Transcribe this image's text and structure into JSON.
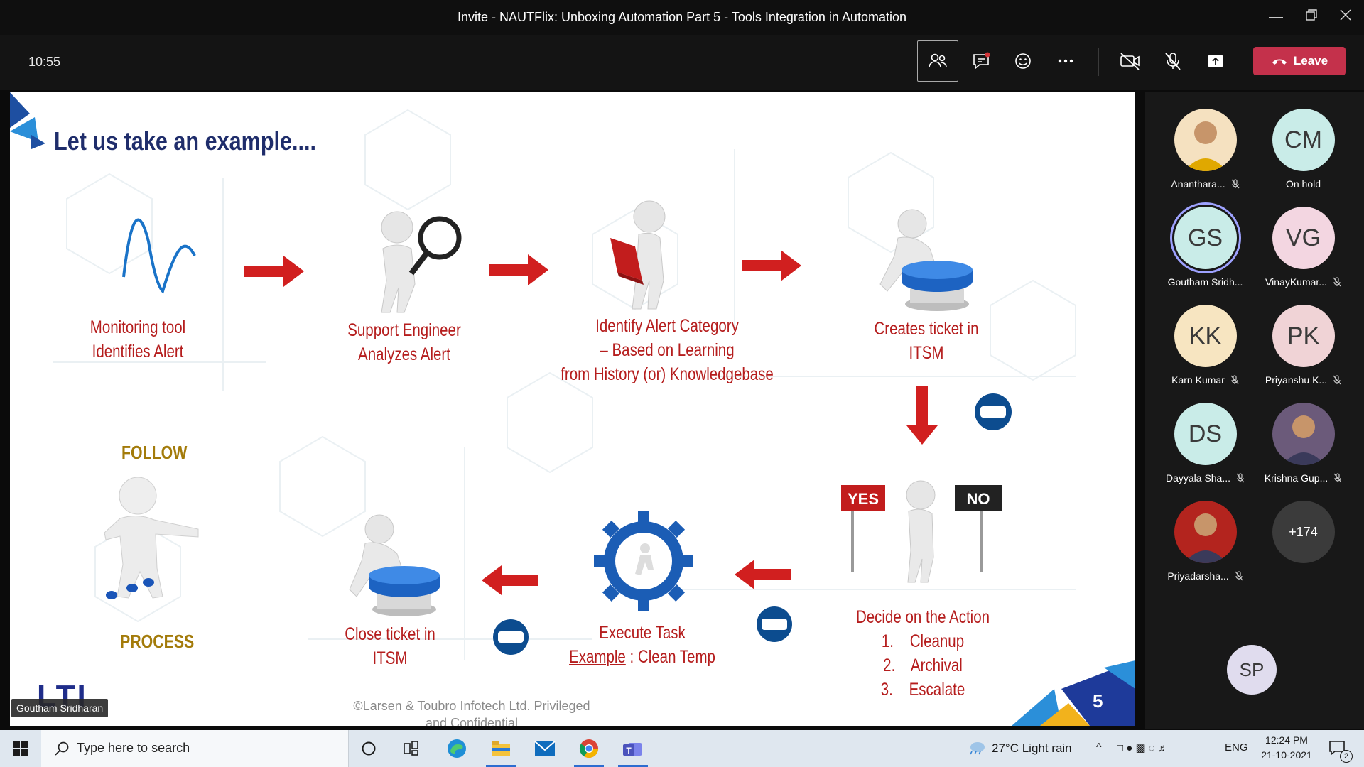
{
  "window": {
    "title": "Invite - NAUTFlix: Unboxing Automation Part 5 - Tools Integration in Automation",
    "controls": [
      "minimize",
      "restore",
      "close"
    ]
  },
  "toolbar": {
    "clock": "10:55",
    "buttons": [
      "people-icon",
      "chat-icon",
      "raise-hand-icon",
      "more-icon",
      "camera-off-icon",
      "mic-off-icon",
      "share-icon"
    ],
    "leave_label": "Leave",
    "leave_color": "#c4314b"
  },
  "slide": {
    "title": "Let us take an example....",
    "steps": {
      "s1": [
        "Monitoring tool",
        "Identifies Alert"
      ],
      "s2": [
        "Support Engineer",
        "Analyzes Alert"
      ],
      "s3": [
        "Identify Alert Category",
        "– Based on Learning",
        "from History (or) Knowledgebase"
      ],
      "s4": [
        "Creates ticket in",
        "ITSM"
      ],
      "s5": [
        "Decide on the Action",
        "1.    Cleanup",
        "2.    Archival",
        "3.    Escalate"
      ],
      "s6_example": "Example",
      "s6_rest": " : Clean Temp",
      "s6_title": "Execute Task",
      "s7": [
        "Close ticket in",
        "ITSM"
      ]
    },
    "follow": "FOLLOW",
    "process": "PROCESS",
    "yes": "YES",
    "no": "NO",
    "logo": "LTI",
    "copyright": "©Larsen & Toubro Infotech Ltd. Privileged and Confidential",
    "page_number": "5",
    "presenter": "Goutham Sridharan",
    "accent_red": "#b51d1d",
    "title_color": "#1f2d6b"
  },
  "participants": [
    {
      "name": "Ananthara...",
      "initials": "",
      "photo": true,
      "muted": true,
      "bg": "#f5e1c0"
    },
    {
      "name": "On hold",
      "initials": "CM",
      "photo": false,
      "muted": false,
      "bg": "#c9ece8"
    },
    {
      "name": "Goutham Sridh...",
      "initials": "GS",
      "photo": false,
      "muted": false,
      "bg": "#c9ece8",
      "speaking": true
    },
    {
      "name": "VinayKumar...",
      "initials": "VG",
      "photo": false,
      "muted": true,
      "bg": "#f3d6e1"
    },
    {
      "name": "Karn Kumar",
      "initials": "KK",
      "photo": false,
      "muted": true,
      "bg": "#f7e5c1"
    },
    {
      "name": "Priyanshu K...",
      "initials": "PK",
      "photo": false,
      "muted": true,
      "bg": "#f0d3d6"
    },
    {
      "name": "Dayyala Sha...",
      "initials": "DS",
      "photo": false,
      "muted": true,
      "bg": "#c9ece8"
    },
    {
      "name": "Krishna Gup...",
      "initials": "",
      "photo": true,
      "muted": true,
      "bg": "#6b5a7a"
    },
    {
      "name": "Priyadarsha...",
      "initials": "",
      "photo": true,
      "muted": true,
      "bg": "#b3241e"
    },
    {
      "name": "",
      "initials": "+174",
      "photo": false,
      "muted": false,
      "bg": "#3b3b3b"
    }
  ],
  "self_view": {
    "initials": "SP",
    "bg": "#e0dcee"
  },
  "taskbar": {
    "search_placeholder": "Type here to search",
    "weather": "27°C  Light rain",
    "language": "ENG",
    "time": "12:24 PM",
    "date": "21-10-2021",
    "notifications": "2",
    "apps": [
      "task-view-icon",
      "edge-icon",
      "file-explorer-icon",
      "mail-icon",
      "chrome-icon",
      "teams-icon"
    ]
  }
}
